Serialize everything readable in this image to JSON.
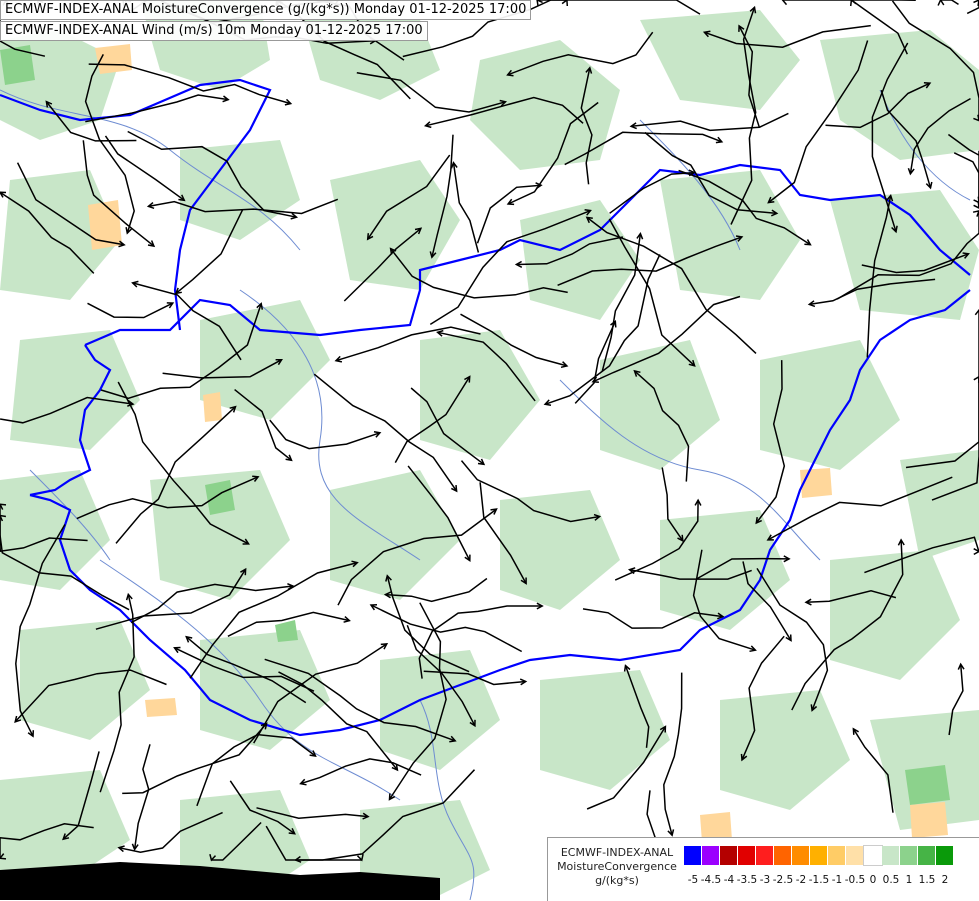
{
  "titles": {
    "line1": "ECMWF-INDEX-ANAL MoistureConvergence (g/(kg*s)) Monday 01-12-2025 17:00",
    "line2": "ECMWF-INDEX-ANAL Wind (m/s) 10m Monday 01-12-2025 17:00"
  },
  "legend": {
    "model": "ECMWF-INDEX-ANAL",
    "parameter": "MoistureConvergence",
    "unit": "g/(kg*s)",
    "ticks": [
      "-5",
      "-4.5",
      "-4",
      "-3.5",
      "-3",
      "-2.5",
      "-2",
      "-1.5",
      "-1",
      "-0.5",
      "0",
      "0.5",
      "1",
      "1.5",
      "2"
    ],
    "colors": [
      "#0000ff",
      "#9b00ff",
      "#b40000",
      "#e10000",
      "#ff1e1e",
      "#ff6400",
      "#ff8c00",
      "#ffb000",
      "#ffcc66",
      "#ffe0a8",
      "#ffffff",
      "#c8e6c8",
      "#8cd28c",
      "#46b446",
      "#0a9a0a"
    ]
  },
  "colors": {
    "border": "#0000ff",
    "river": "#6e8cd2",
    "streamline": "#000000",
    "light_green": "#c8e6c8",
    "mid_green": "#8cd28c",
    "dark_green": "#46b446",
    "light_orange": "#ffd79b",
    "mid_orange": "#ffb450"
  }
}
